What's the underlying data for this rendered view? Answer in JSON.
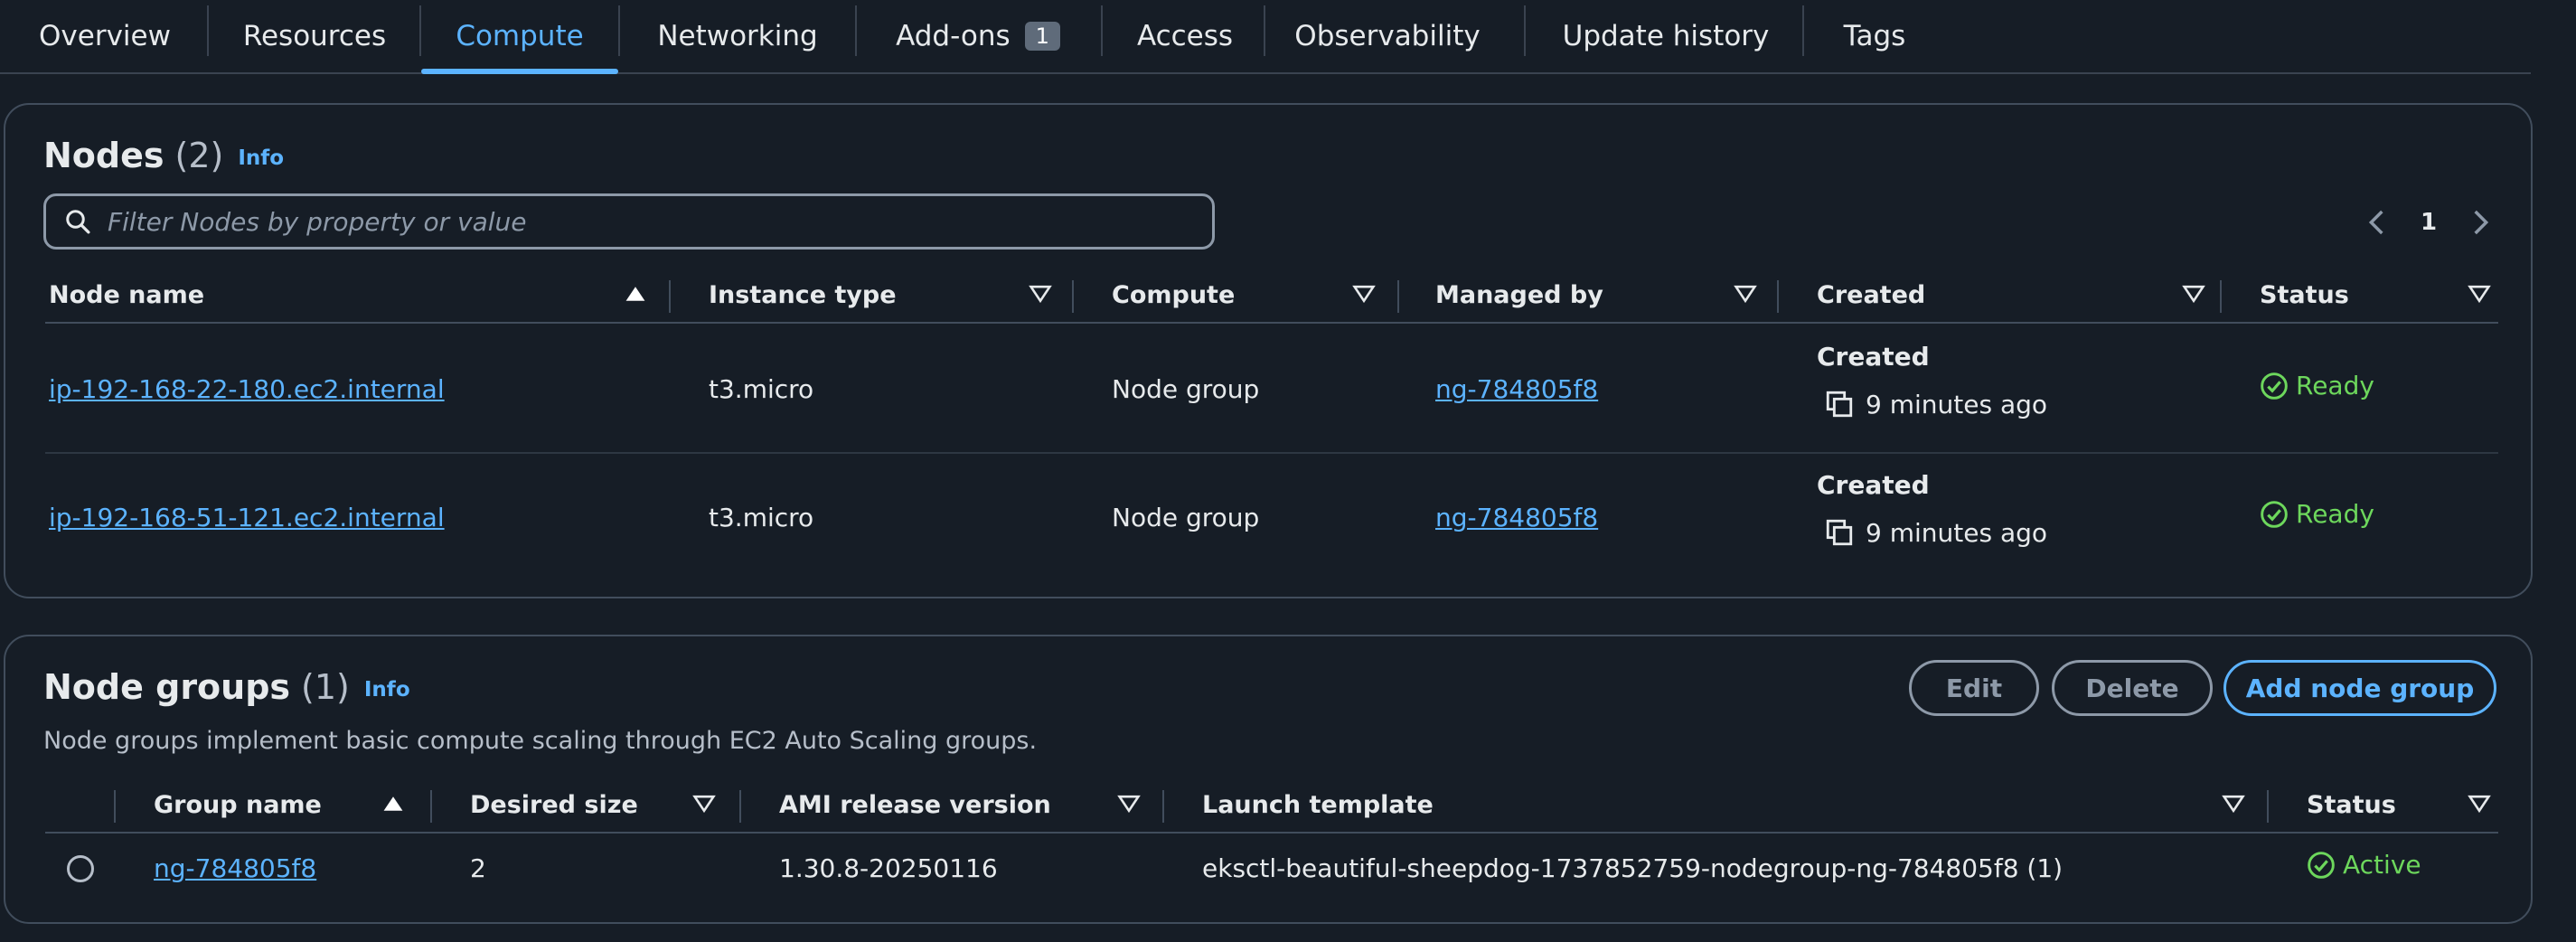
{
  "tabs": [
    {
      "label": "Overview"
    },
    {
      "label": "Resources"
    },
    {
      "label": "Compute"
    },
    {
      "label": "Networking"
    },
    {
      "label": "Add-ons",
      "badge": "1"
    },
    {
      "label": "Access"
    },
    {
      "label": "Observability"
    },
    {
      "label": "Update history"
    },
    {
      "label": "Tags"
    }
  ],
  "active_tab": "Compute",
  "nodes": {
    "title": "Nodes",
    "count": "(2)",
    "info": "Info",
    "filter_placeholder": "Filter Nodes by property or value",
    "page": "1",
    "columns": [
      "Node name",
      "Instance type",
      "Compute",
      "Managed by",
      "Created",
      "Status"
    ],
    "rows": [
      {
        "name": "ip-192-168-22-180.ec2.internal",
        "instance_type": "t3.micro",
        "compute": "Node group",
        "managed_by": "ng-784805f8",
        "created_label": "Created",
        "created_value": "9 minutes ago",
        "status": "Ready"
      },
      {
        "name": "ip-192-168-51-121.ec2.internal",
        "instance_type": "t3.micro",
        "compute": "Node group",
        "managed_by": "ng-784805f8",
        "created_label": "Created",
        "created_value": "9 minutes ago",
        "status": "Ready"
      }
    ]
  },
  "node_groups": {
    "title": "Node groups",
    "count": "(1)",
    "info": "Info",
    "description": "Node groups implement basic compute scaling through EC2 Auto Scaling groups.",
    "buttons": {
      "edit": "Edit",
      "delete": "Delete",
      "add": "Add node group"
    },
    "columns": [
      "Group name",
      "Desired size",
      "AMI release version",
      "Launch template",
      "Status"
    ],
    "rows": [
      {
        "group_name": "ng-784805f8",
        "desired_size": "2",
        "ami_release_version": "1.30.8-20250116",
        "launch_template": "eksctl-beautiful-sheepdog-1737852759-nodegroup-ng-784805f8 (1)",
        "status": "Active"
      }
    ]
  },
  "colors": {
    "background": "#161d26",
    "accent": "#5cb3ff",
    "success": "#6dd75c",
    "border": "#414d5c"
  }
}
